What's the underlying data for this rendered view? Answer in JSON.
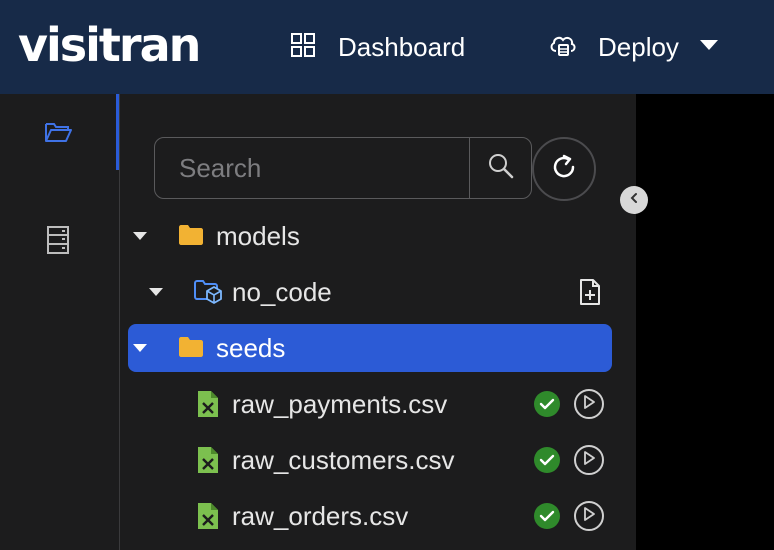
{
  "app": {
    "logo_text": "visitran"
  },
  "nav": {
    "dashboard_label": "Dashboard",
    "deploy_label": "Deploy"
  },
  "search": {
    "placeholder": "Search",
    "value": ""
  },
  "colors": {
    "topbar": "#172a48",
    "selected": "#2c5bd6",
    "folder": "#f2b233",
    "csv": "#7cc04f",
    "success": "#2f8a2b",
    "accent": "#2a5bd7"
  },
  "tree": {
    "models": {
      "label": "models",
      "expanded": true
    },
    "no_code": {
      "label": "no_code",
      "expanded": true
    },
    "seeds": {
      "label": "seeds",
      "expanded": true,
      "selected": true
    },
    "files": [
      {
        "label": "raw_payments.csv",
        "status": "success"
      },
      {
        "label": "raw_customers.csv",
        "status": "success"
      },
      {
        "label": "raw_orders.csv",
        "status": "success"
      }
    ]
  }
}
